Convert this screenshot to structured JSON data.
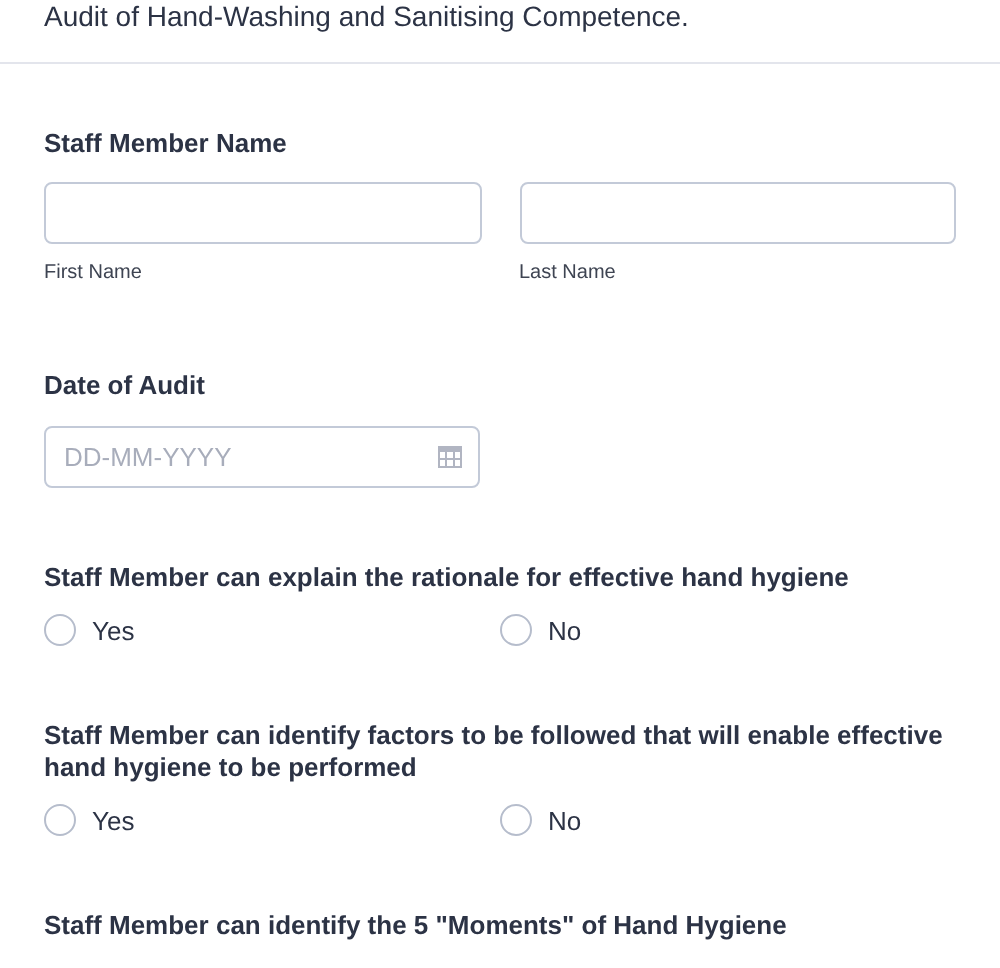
{
  "header": {
    "description": "Audit of Hand-Washing and Sanitising Competence."
  },
  "name_field": {
    "label": "Staff Member Name",
    "parts": [
      {
        "sublabel": "First Name"
      },
      {
        "sublabel": "Last Name"
      }
    ]
  },
  "date_field": {
    "label": "Date of Audit",
    "placeholder": "DD-MM-YYYY"
  },
  "questions": [
    {
      "label": "Staff Member can explain the rationale for effective hand hygiene",
      "options": [
        {
          "label": "Yes",
          "selected": false
        },
        {
          "label": "No",
          "selected": false
        }
      ]
    },
    {
      "label": "Staff Member can identify factors to be followed that will enable effective hand hygiene to be performed",
      "options": [
        {
          "label": "Yes",
          "selected": false
        },
        {
          "label": "No",
          "selected": false
        }
      ]
    },
    {
      "label": "Staff Member can identify the 5 \"Moments\" of Hand Hygiene"
    }
  ]
}
